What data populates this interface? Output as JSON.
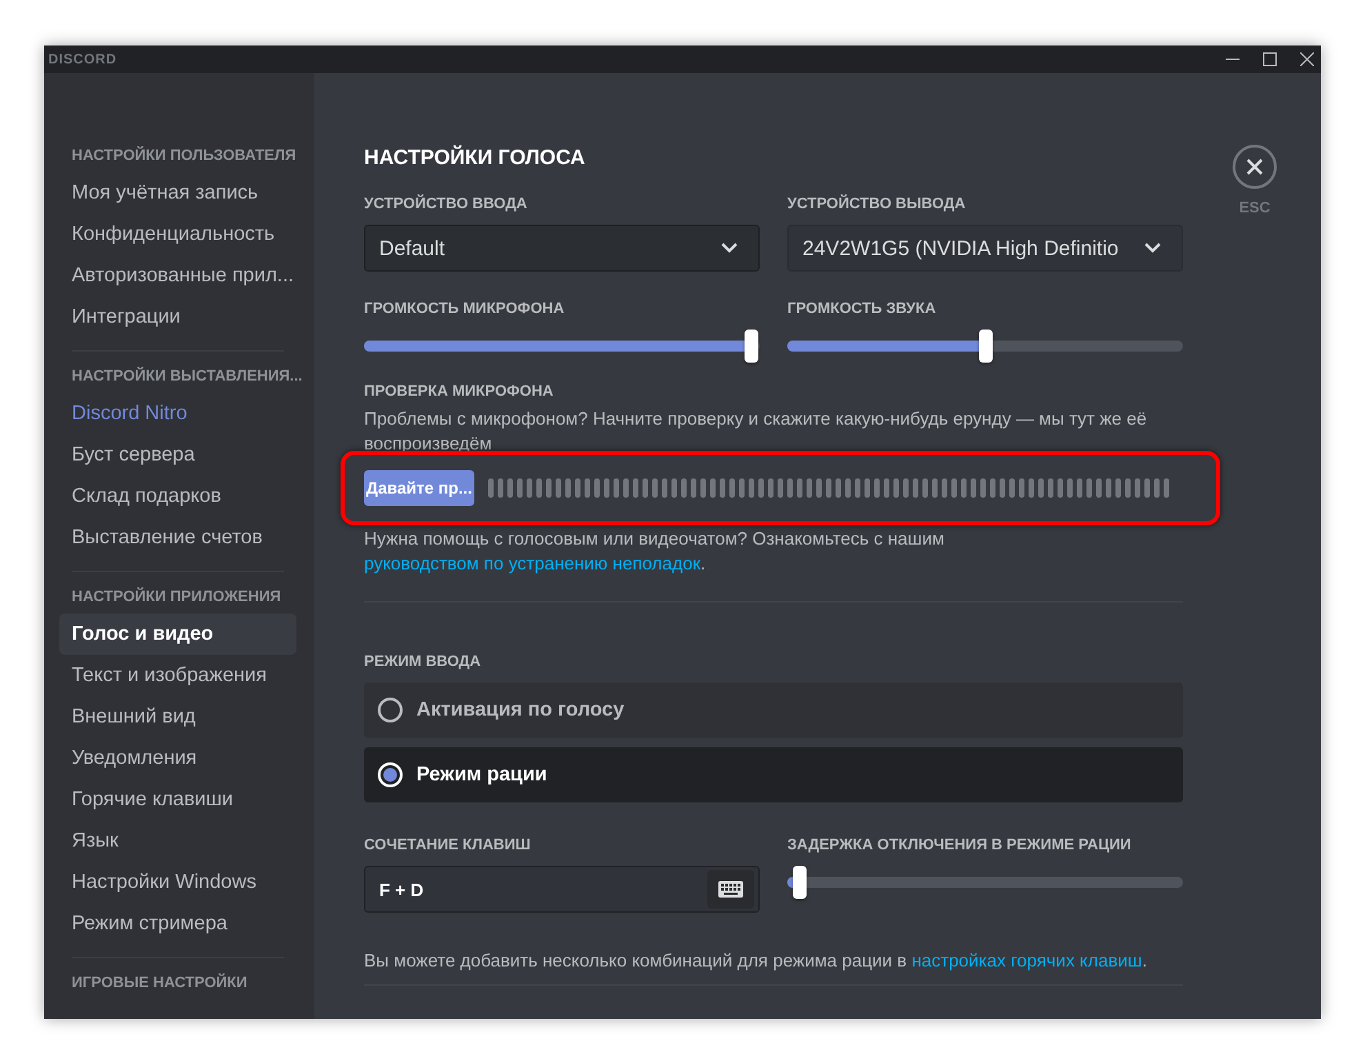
{
  "window": {
    "title": "DISCORD"
  },
  "sidebar": {
    "sections": [
      {
        "header": "НАСТРОЙКИ ПОЛЬЗОВАТЕЛЯ",
        "items": [
          {
            "label": "Моя учётная запись",
            "kind": "normal",
            "selected": false
          },
          {
            "label": "Конфиденциальность",
            "kind": "normal",
            "selected": false
          },
          {
            "label": "Авторизованные прил...",
            "kind": "normal",
            "selected": false
          },
          {
            "label": "Интеграции",
            "kind": "normal",
            "selected": false
          }
        ]
      },
      {
        "header": "НАСТРОЙКИ ВЫСТАВЛЕНИЯ...",
        "items": [
          {
            "label": "Discord Nitro",
            "kind": "accent",
            "selected": false
          },
          {
            "label": "Буст сервера",
            "kind": "normal",
            "selected": false
          },
          {
            "label": "Склад подарков",
            "kind": "normal",
            "selected": false
          },
          {
            "label": "Выставление счетов",
            "kind": "normal",
            "selected": false
          }
        ]
      },
      {
        "header": "НАСТРОЙКИ ПРИЛОЖЕНИЯ",
        "items": [
          {
            "label": "Голос и видео",
            "kind": "normal",
            "selected": true
          },
          {
            "label": "Текст и изображения",
            "kind": "normal",
            "selected": false
          },
          {
            "label": "Внешний вид",
            "kind": "normal",
            "selected": false
          },
          {
            "label": "Уведомления",
            "kind": "normal",
            "selected": false
          },
          {
            "label": "Горячие клавиши",
            "kind": "normal",
            "selected": false
          },
          {
            "label": "Язык",
            "kind": "normal",
            "selected": false
          },
          {
            "label": "Настройки Windows",
            "kind": "normal",
            "selected": false
          },
          {
            "label": "Режим стримера",
            "kind": "normal",
            "selected": false
          }
        ]
      },
      {
        "header": "ИГРОВЫЕ НАСТРОЙКИ"
      }
    ]
  },
  "content": {
    "title": "НАСТРОЙКИ ГОЛОСА",
    "close_label": "ESC",
    "input_device": {
      "label": "УСТРОЙСТВО ВВОДА",
      "value": "Default"
    },
    "output_device": {
      "label": "УСТРОЙСТВО ВЫВОДА",
      "value": "24V2W1G5 (NVIDIA High Definitio"
    },
    "mic_volume": {
      "label": "ГРОМКОСТЬ МИКРОФОНА",
      "level": 0.98
    },
    "output_volume": {
      "label": "ГРОМКОСТЬ ЗВУКА",
      "level": 0.5
    },
    "mic_test": {
      "label": "ПРОВЕРКА МИКРОФОНА",
      "description": "Проблемы с микрофоном? Начните проверку и скажите какую-нибудь ерунду — мы тут же её воспроизведём",
      "button": "Давайте пр..."
    },
    "help": {
      "before": "Нужна помощь с голосовым или видеочатом? Ознакомьтесь с нашим ",
      "link": "руководством по устранению неполадок",
      "after": "."
    },
    "input_mode": {
      "label": "РЕЖИМ ВВОДА",
      "options": [
        {
          "label": "Активация по голосу",
          "selected": false
        },
        {
          "label": "Режим рации",
          "selected": true
        }
      ]
    },
    "shortcut": {
      "label": "СОЧЕТАНИЕ КЛАВИШ",
      "value": "F + D"
    },
    "release_delay": {
      "label": "ЗАДЕРЖКА ОТКЛЮЧЕНИЯ В РЕЖИМЕ РАЦИИ",
      "level": 0.02
    },
    "note": {
      "before": "Вы можете добавить несколько комбинаций для режима рации в ",
      "link": "настройках горячих клавиш",
      "after": "."
    }
  }
}
